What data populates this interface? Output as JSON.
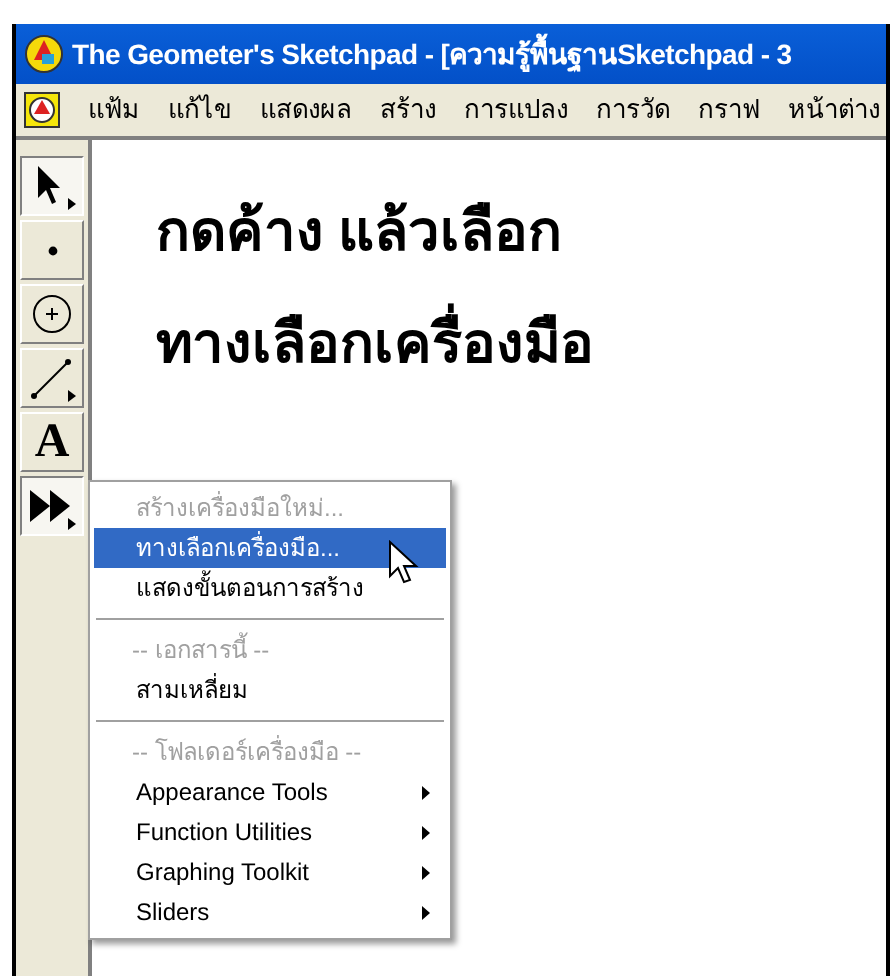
{
  "window": {
    "title": "The Geometer's Sketchpad - [ความรู้พื้นฐานSketchpad - 3"
  },
  "menu_bar": [
    "แฟ้ม",
    "แก้ไข",
    "แสดงผล",
    "สร้าง",
    "การแปลง",
    "การวัด",
    "กราฟ",
    "หน้าต่าง"
  ],
  "toolbox": [
    {
      "kind": "arrow",
      "selected": true
    },
    {
      "kind": "point",
      "selected": false
    },
    {
      "kind": "compass",
      "selected": false
    },
    {
      "kind": "line",
      "selected": false
    },
    {
      "kind": "text",
      "label": "A",
      "selected": false
    },
    {
      "kind": "custom",
      "selected": true
    }
  ],
  "canvas": {
    "lines": [
      "กดค้าง แล้วเลือก",
      "ทางเลือกเครื่องมือ"
    ]
  },
  "context_menu": [
    {
      "kind": "item",
      "label": "สร้างเครื่องมือใหม่...",
      "disabled": true,
      "selected": false
    },
    {
      "kind": "item",
      "label": "ทางเลือกเครื่องมือ...",
      "disabled": false,
      "selected": true
    },
    {
      "kind": "item",
      "label": "แสดงขั้นตอนการสร้าง",
      "disabled": false,
      "selected": false
    },
    {
      "kind": "separator"
    },
    {
      "kind": "header",
      "label": "-- เอกสารนี้ --"
    },
    {
      "kind": "item",
      "label": "สามเหลี่ยม",
      "disabled": false,
      "selected": false
    },
    {
      "kind": "separator"
    },
    {
      "kind": "header",
      "label": "-- โฟลเดอร์เครื่องมือ --"
    },
    {
      "kind": "submenu",
      "label": "Appearance Tools"
    },
    {
      "kind": "submenu",
      "label": "Function Utilities"
    },
    {
      "kind": "submenu",
      "label": "Graphing Toolkit"
    },
    {
      "kind": "submenu",
      "label": "Sliders"
    }
  ]
}
